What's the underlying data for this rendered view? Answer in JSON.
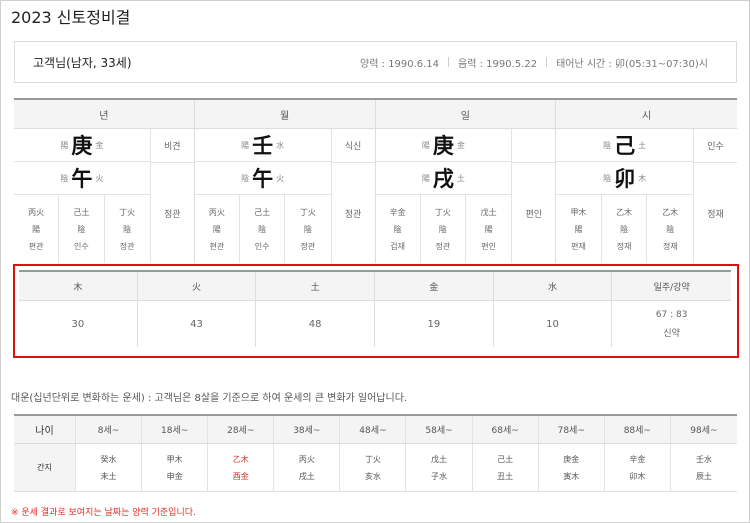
{
  "title": "2023 신토정비결",
  "profile": {
    "name": "고객님(남자, 33세)",
    "solar": "양력 : 1990.6.14",
    "lunar": "음력 : 1990.5.22",
    "birth_time": "태어난 시간 : 卯(05:31~07:30)시"
  },
  "saju": {
    "headers": [
      "년",
      "월",
      "일",
      "시"
    ],
    "pillars": [
      {
        "stem_yy": "陽",
        "stem": "庚",
        "stem_el": "金",
        "stem_god": "비견",
        "branch_yy": "陰",
        "branch": "午",
        "branch_el": "火",
        "branch_god": "정관",
        "hidden": [
          [
            "丙火",
            "陽",
            "편관"
          ],
          [
            "己土",
            "陰",
            "인수"
          ],
          [
            "丁火",
            "陰",
            "정관"
          ]
        ]
      },
      {
        "stem_yy": "陽",
        "stem": "壬",
        "stem_el": "水",
        "stem_god": "식신",
        "branch_yy": "陰",
        "branch": "午",
        "branch_el": "火",
        "branch_god": "정관",
        "hidden": [
          [
            "丙火",
            "陽",
            "편관"
          ],
          [
            "己土",
            "陰",
            "인수"
          ],
          [
            "丁火",
            "陰",
            "정관"
          ]
        ]
      },
      {
        "stem_yy": "陽",
        "stem": "庚",
        "stem_el": "金",
        "stem_god": "",
        "branch_yy": "陽",
        "branch": "戌",
        "branch_el": "土",
        "branch_god": "편인",
        "hidden": [
          [
            "辛金",
            "陰",
            "겁재"
          ],
          [
            "丁火",
            "陰",
            "정관"
          ],
          [
            "戊土",
            "陽",
            "편인"
          ]
        ]
      },
      {
        "stem_yy": "陰",
        "stem": "己",
        "stem_el": "土",
        "stem_god": "인수",
        "branch_yy": "陰",
        "branch": "卯",
        "branch_el": "木",
        "branch_god": "정재",
        "hidden": [
          [
            "甲木",
            "陽",
            "편재"
          ],
          [
            "乙木",
            "陰",
            "정재"
          ],
          [
            "乙木",
            "陰",
            "정재"
          ]
        ]
      }
    ]
  },
  "elements": {
    "headers": [
      "木",
      "火",
      "土",
      "金",
      "水",
      "일주/강약"
    ],
    "values": [
      "30",
      "43",
      "48",
      "19",
      "10"
    ],
    "strength_ratio": "67 : 83",
    "strength_label": "신약"
  },
  "daeun": {
    "note": "대운(십년단위로 변화하는 운세) : 고객님은 8살을 기준으로 하여 운세의 큰 변화가 일어납니다.",
    "age_label": "나이",
    "ganji_label": "간지",
    "ages": [
      "8세~",
      "18세~",
      "28세~",
      "38세~",
      "48세~",
      "58세~",
      "68세~",
      "78세~",
      "88세~",
      "98세~"
    ],
    "stems": [
      "癸水",
      "甲木",
      "乙木",
      "丙火",
      "丁火",
      "戊土",
      "己土",
      "庚金",
      "辛金",
      "壬水"
    ],
    "branches": [
      "未土",
      "申金",
      "酉金",
      "戌土",
      "亥水",
      "子水",
      "丑土",
      "寅木",
      "卯木",
      "辰土"
    ],
    "current_index": 2,
    "current_color": "#c0392b"
  },
  "footnote": "※ 운세 결과로 보여지는 날짜는 양력 기준입니다.",
  "colors": {
    "highlight_border": "#e01010",
    "footnote": "#e0302a"
  }
}
